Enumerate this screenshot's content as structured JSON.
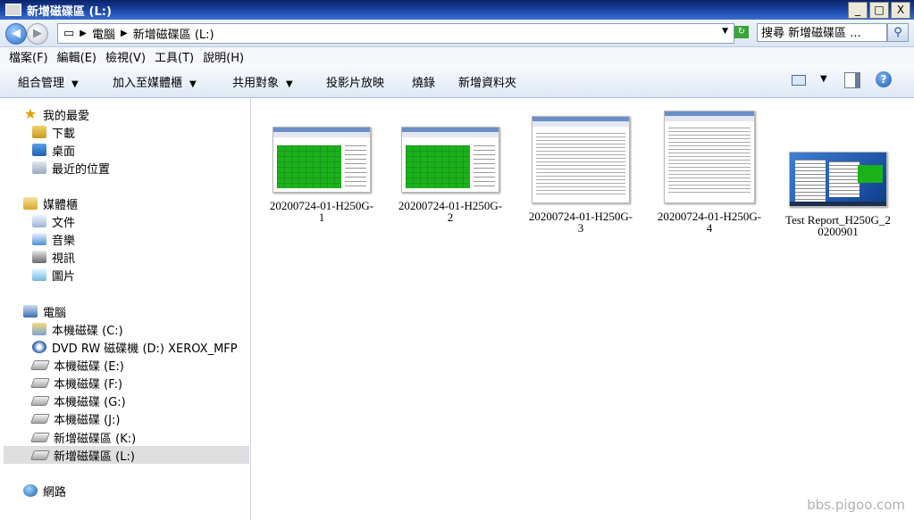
{
  "window": {
    "title": "新增磁碟區 (L:)",
    "buttons": {
      "minimize": "_",
      "maximize": "□",
      "close": "X"
    }
  },
  "addressbar": {
    "segments": [
      "電腦",
      "新增磁碟區 (L:)"
    ],
    "search_placeholder": "搜尋 新增磁碟區 ..."
  },
  "menubar": {
    "items": [
      "檔案(F)",
      "編輯(E)",
      "檢視(V)",
      "工具(T)",
      "說明(H)"
    ]
  },
  "toolbar": {
    "organize": "組合管理",
    "add_to_library": "加入至媒體櫃",
    "share_with": "共用對象",
    "slideshow": "投影片放映",
    "burn": "燒錄",
    "new_folder": "新增資料夾"
  },
  "navpane": {
    "favorites": {
      "label": "我的最愛",
      "items": [
        "下載",
        "桌面",
        "最近的位置"
      ]
    },
    "libraries": {
      "label": "媒體櫃",
      "items": [
        "文件",
        "音樂",
        "視訊",
        "圖片"
      ]
    },
    "computer": {
      "label": "電腦",
      "items": [
        "本機磁碟 (C:)",
        "DVD RW 磁碟機 (D:) XEROX_MFP",
        "本機磁碟 (E:)",
        "本機磁碟 (F:)",
        "本機磁碟 (G:)",
        "本機磁碟 (J:)",
        "新增磁碟區 (K:)",
        "新增磁碟區 (L:)"
      ],
      "selected": "新增磁碟區 (L:)"
    },
    "network": {
      "label": "網路"
    }
  },
  "files": [
    {
      "name": "20200724-01-H250G-1",
      "thumb": "disk-test-green"
    },
    {
      "name": "20200724-01-H250G-2",
      "thumb": "disk-test-green"
    },
    {
      "name": "20200724-01-H250G-3",
      "thumb": "info-window"
    },
    {
      "name": "20200724-01-H250G-4",
      "thumb": "report-window"
    },
    {
      "name": "Test Report_H250G_20200901",
      "thumb": "desktop-screenshot"
    }
  ],
  "watermark": "bbs.pigoo.com",
  "colors": {
    "titlebar": "#0a246a",
    "selection": "#dedede",
    "test_green": "#1bb11b"
  }
}
